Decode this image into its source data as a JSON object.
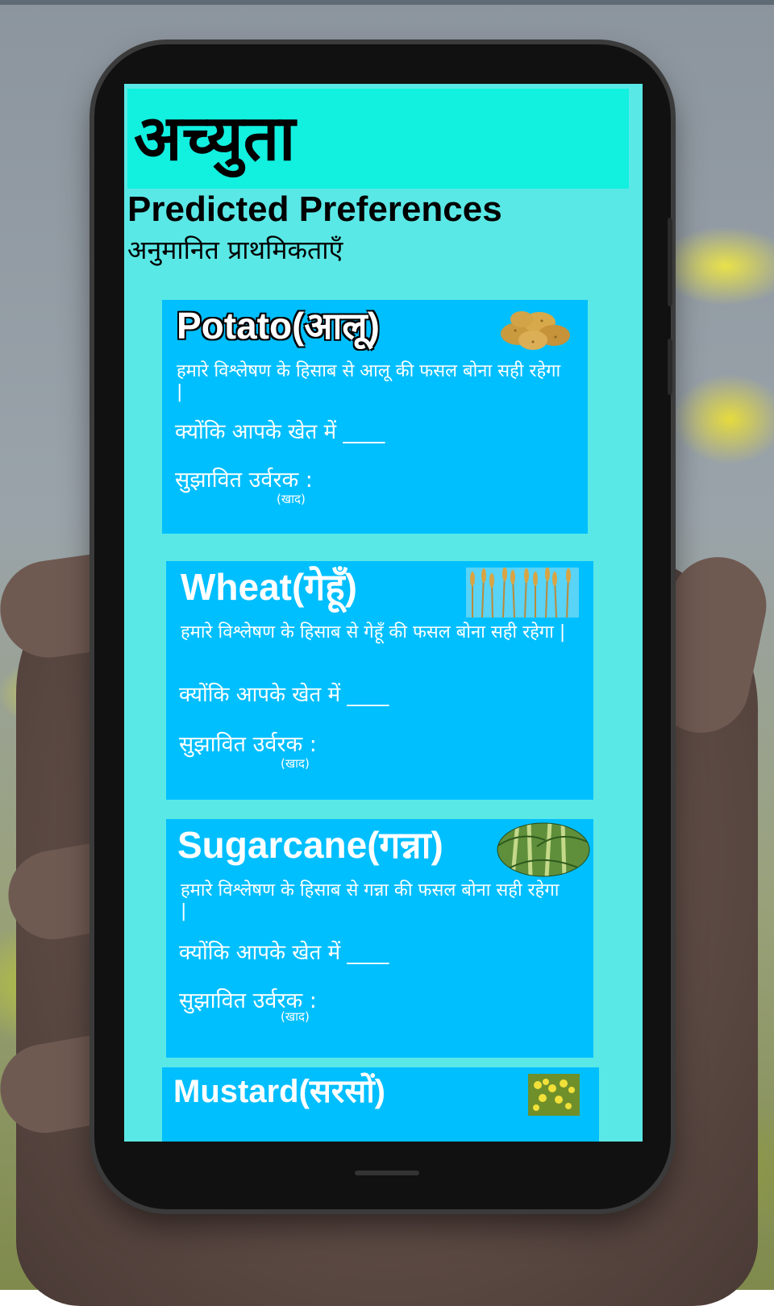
{
  "app": {
    "title": "अच्युता"
  },
  "page": {
    "heading": "Predicted Preferences",
    "subheading": "अनुमानित प्राथमिकताएँ"
  },
  "cards": [
    {
      "title": "Potato(आलू)",
      "image": "potato-image",
      "recommendation": "हमारे विश्लेषण के हिसाब से आलू की फसल बोना सही  रहेगा |",
      "reason": "क्योंकि आपके खेत में ____",
      "fertilizer_label": "सुझावित उर्वरक :",
      "fertilizer_sub": "(खाद)"
    },
    {
      "title": "Wheat(गेहूँ)",
      "image": "wheat-image",
      "recommendation": "हमारे विश्लेषण के हिसाब से  गेहूँ  की फसल बोना सही  रहेगा |",
      "reason": "क्योंकि आपके खेत में ____",
      "fertilizer_label": "सुझावित उर्वरक :",
      "fertilizer_sub": "(खाद)"
    },
    {
      "title": "Sugarcane(गन्ना)",
      "image": "sugarcane-image",
      "recommendation": "हमारे विश्लेषण के हिसाब से गन्ना की फसल बोना सही  रहेगा |",
      "reason": "क्योंकि आपके खेत में ____",
      "fertilizer_label": "सुझावित उर्वरक :",
      "fertilizer_sub": "(खाद)"
    },
    {
      "title": "Mustard(सरसों)",
      "image": "mustard-image"
    }
  ],
  "colors": {
    "screen_bg": "#5ae8e6",
    "header_bg": "#12f0e0",
    "card_bg": "#00bfff"
  }
}
